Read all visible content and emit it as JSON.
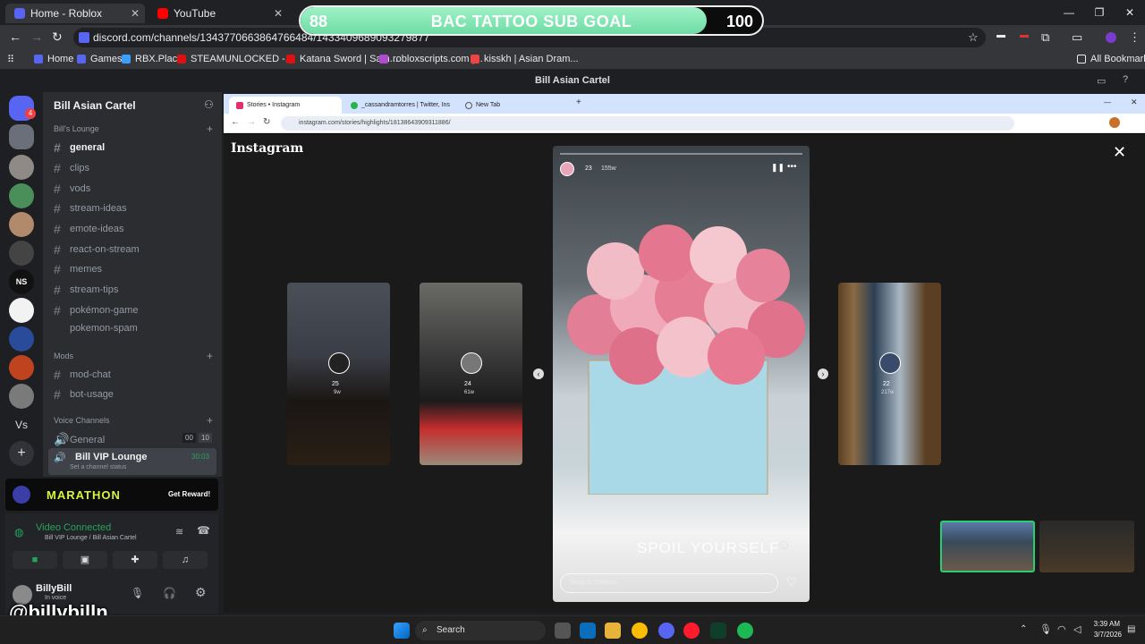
{
  "browser": {
    "tabs": [
      {
        "label": "Home - Roblox",
        "color": "#5865f2"
      },
      {
        "label": "YouTube",
        "color": "#ff0000"
      }
    ],
    "url": "discord.com/channels/1343770663864766484/1433409689093279877",
    "bookmarks": [
      {
        "label": "Home",
        "color": "#5865f2"
      },
      {
        "label": "Games",
        "color": "#5865f2"
      },
      {
        "label": "RBX.Place",
        "color": "#3aa0ff"
      },
      {
        "label": "STEAMUNLOCKED -...",
        "color": "#d11"
      },
      {
        "label": "Katana Sword | Sam...",
        "color": "#d11"
      },
      {
        "label": "robloxscripts.com |...",
        "color": "#b04ad0"
      },
      {
        "label": "kisskh | Asian Dram...",
        "color": "#e44"
      }
    ],
    "all_bookmarks": "All Bookmarks"
  },
  "subgoal": {
    "current": "88",
    "title": "BAC TATTOO SUB GOAL",
    "max": "100",
    "progress_fraction": 0.88
  },
  "discord": {
    "window_title": "Bill Asian Cartel",
    "guild_name": "Bill Asian Cartel",
    "categories": {
      "lounge": "Bill's Lounge",
      "mods": "Mods",
      "voice": "Voice Channels"
    },
    "channels": [
      "general",
      "clips",
      "vods",
      "stream-ideas",
      "emote-ideas",
      "react-on-stream",
      "memes",
      "stream-tips",
      "pokémon-game",
      "pokemon-spam"
    ],
    "mod_channels": [
      "mod-chat",
      "bot-usage"
    ],
    "voice_channels": [
      {
        "name": "General",
        "counts": [
          "00",
          "10"
        ]
      },
      {
        "name": "Bill VIP Lounge",
        "time": "30:03",
        "status": "Set a channel status"
      }
    ],
    "marathon": {
      "label": "MARATHON",
      "cta": "Get Reward!"
    },
    "voice": {
      "state": "Video Connected",
      "location": "Bill VIP Lounge / Bill Asian Cartel"
    },
    "user": {
      "name": "BillyBill",
      "status": "In voice"
    },
    "notif_badge": "4",
    "server_initials": [
      "NS",
      "Vs"
    ]
  },
  "inner_browser": {
    "tabs": [
      "Stories • Instagram",
      "_cassandramtorres | Twitter, Ins",
      "New Tab"
    ],
    "url": "instagram.com/stories/highlights/18138643909311886/"
  },
  "instagram": {
    "logo": "Instagram",
    "side_stories": [
      {
        "count": "25",
        "age": "9w"
      },
      {
        "count": "24",
        "age": "61w"
      },
      {
        "count": "22",
        "age": "217w"
      }
    ],
    "main_story": {
      "count": "23",
      "age": "155w",
      "caption": "SPOIL YOURSELF",
      "reply_placeholder": "Reply to lilbillbae..."
    }
  },
  "overlay": {
    "handle": "@billybilln"
  },
  "taskbar": {
    "search": "Search",
    "time": "3:39 AM",
    "date": "3/7/2026"
  }
}
